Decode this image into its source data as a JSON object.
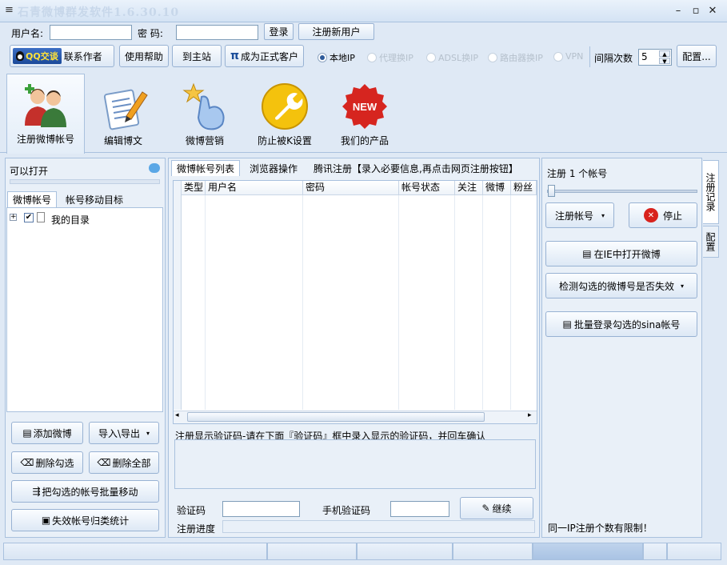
{
  "window": {
    "title": "石青微博群发软件1.6.30.10"
  },
  "login": {
    "username_label": "用户名:",
    "password_label": "密  码:",
    "login_button": "登录",
    "register_button": "注册新用户"
  },
  "toolbar": {
    "qq_badge": "QQ交谈",
    "contact": "联系作者",
    "help": "使用帮助",
    "home": "到主站",
    "upgrade": "成为正式客户",
    "pi_symbol": "π"
  },
  "ip_options": [
    {
      "label": "本地IP",
      "selected": true,
      "enabled": true
    },
    {
      "label": "代理换IP",
      "selected": false,
      "enabled": false
    },
    {
      "label": "ADSL换IP",
      "selected": false,
      "enabled": false
    },
    {
      "label": "路由器换IP",
      "selected": false,
      "enabled": false
    },
    {
      "label": "VPN",
      "selected": false,
      "enabled": false
    }
  ],
  "interval": {
    "label": "间隔次数",
    "value": "5"
  },
  "config_button": "配置...",
  "tools": [
    {
      "label": "注册微博帐号",
      "icon": "users-icon"
    },
    {
      "label": "编辑博文",
      "icon": "edit-document-icon"
    },
    {
      "label": "微博营销",
      "icon": "hand-star-icon"
    },
    {
      "label": "防止被K设置",
      "icon": "wrench-icon"
    },
    {
      "label": "我们的产品",
      "icon": "new-badge-icon"
    }
  ],
  "left": {
    "status": "可以打开",
    "tabs": [
      "微博帐号",
      "帐号移动目标"
    ],
    "tree_root": "我的目录",
    "buttons": {
      "add": "添加微博",
      "import_export": "导入\\导出",
      "delete_checked": "删除勾选",
      "delete_all": "删除全部",
      "batch_move": "把勾选的帐号批量移动",
      "invalid_stats": "失效帐号归类统计"
    }
  },
  "center": {
    "tabs": [
      "微博帐号列表",
      "浏览器操作",
      "腾讯注册【录入必要信息,再点击网页注册按钮】"
    ],
    "columns": [
      "类型",
      "用户名",
      "密码",
      "帐号状态",
      "关注",
      "微博",
      "粉丝"
    ],
    "captcha_hint": "注册显示验证码-请在下面『验证码』框中录入显示的验证码，并回车确认",
    "captcha_label": "验证码",
    "phone_label": "手机验证码",
    "continue_button": "继续",
    "progress_label": "注册进度"
  },
  "right": {
    "register_count": "注册 1 个帐号",
    "register_button": "注册帐号",
    "stop_button": "停止",
    "open_ie": "在IE中打开微博",
    "check_invalid": "检测勾选的微博号是否失效",
    "batch_login": "批量登录勾选的sina帐号",
    "notice": "同一IP注册个数有限制！",
    "vtabs": [
      "注册记录",
      "配置"
    ]
  }
}
